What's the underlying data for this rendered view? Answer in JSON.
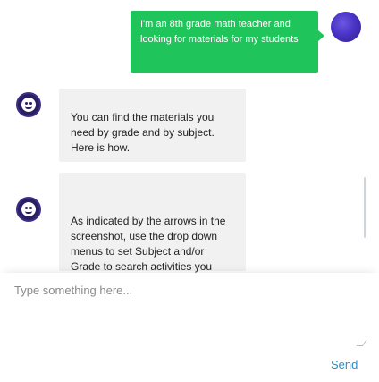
{
  "conversation": {
    "messages": [
      {
        "sender": "user",
        "text": "I'm an 8th grade math teacher and looking for materials for my students"
      },
      {
        "sender": "bot",
        "text": "You can find the materials you need by grade and by subject. Here is how."
      },
      {
        "sender": "bot",
        "text": "As indicated by the arrows in the screenshot, use the drop down menus to set Subject and/or Grade to search activities you want."
      }
    ]
  },
  "composer": {
    "placeholder": "Type something here...",
    "value": "",
    "send_label": "Send"
  },
  "colors": {
    "user_bubble": "#1fc55a",
    "bot_bubble": "#f1f1f1",
    "send_link": "#2a8ec8",
    "bot_avatar": "#2a1f63",
    "user_avatar": "#4a33c7"
  },
  "icons": {
    "user_avatar": "user-avatar-icon",
    "bot_avatar": "chatbot-face-icon",
    "resize": "resize-grip-icon"
  }
}
